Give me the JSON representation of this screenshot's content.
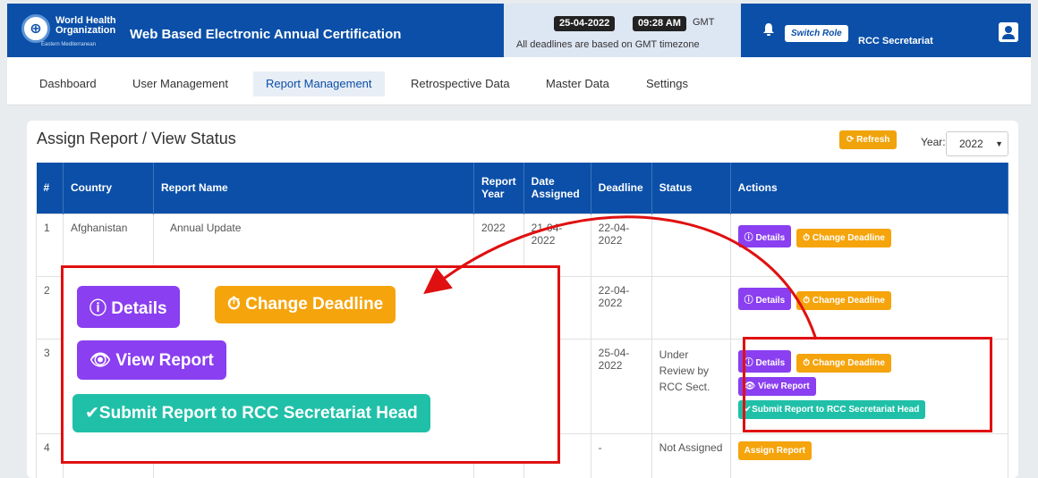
{
  "header": {
    "org_line1": "World Health",
    "org_line2": "Organization",
    "org_line3": "Eastern Mediterranean",
    "title": "Web Based Electronic Annual Certification",
    "date": "25-04-2022",
    "time": "09:28 AM",
    "timezone": "GMT",
    "deadline_note": "All deadlines are based on GMT timezone",
    "switch_role": "Switch Role",
    "role": "RCC Secretariat"
  },
  "nav": {
    "items": [
      "Dashboard",
      "User Management",
      "Report Management",
      "Retrospective Data",
      "Master Data",
      "Settings"
    ],
    "active": "Report Management"
  },
  "page": {
    "title": "Assign Report / View Status",
    "refresh": "Refresh",
    "year_label": "Year:",
    "year_value": "2022"
  },
  "table": {
    "headers": [
      "#",
      "Country",
      "Report Name",
      "Report Year",
      "Date Assigned",
      "Deadline",
      "Status",
      "Actions"
    ],
    "rows": [
      {
        "num": "1",
        "country": "Afghanistan",
        "report": "Annual Update",
        "year": "2022",
        "assigned": "21-04-2022",
        "deadline": "22-04-2022",
        "status": ""
      },
      {
        "num": "2",
        "country": "",
        "report": "",
        "year": "",
        "assigned": "04-2",
        "deadline": "22-04-2022",
        "status": ""
      },
      {
        "num": "3",
        "country": "",
        "report": "",
        "year": "",
        "assigned": "04-2",
        "deadline": "25-04-2022",
        "status": "Under Review by RCC Sect."
      },
      {
        "num": "4",
        "country": "",
        "report": "",
        "year": "",
        "assigned": "",
        "deadline": "-",
        "status": "Not Assigned"
      }
    ]
  },
  "actions": {
    "details": "Details",
    "change_deadline": "Change Deadline",
    "view_report": "View Report",
    "submit": "Submit Report to RCC Secretariat Head",
    "assign": "Assign Report"
  },
  "colors": {
    "primary": "#0b4fa8",
    "purple": "#8a3ff0",
    "orange": "#f5a40c",
    "teal": "#20c0a8",
    "highlight": "#e01010"
  }
}
